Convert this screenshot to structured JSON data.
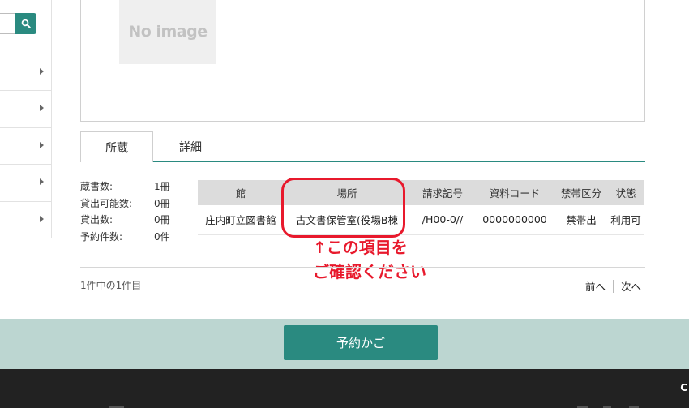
{
  "sidebar": {
    "items": [
      "",
      "",
      "",
      "",
      ""
    ]
  },
  "image_panel": {
    "placeholder_text": "No image"
  },
  "tabs": [
    {
      "label": "所蔵",
      "active": true
    },
    {
      "label": "詳細",
      "active": false
    }
  ],
  "stats": [
    {
      "label": "蔵書数:",
      "value": "1冊"
    },
    {
      "label": "貸出可能数:",
      "value": "0冊"
    },
    {
      "label": "貸出数:",
      "value": "0冊"
    },
    {
      "label": "予約件数:",
      "value": "0件"
    }
  ],
  "holdings": {
    "headers": [
      "館",
      "場所",
      "請求記号",
      "資料コード",
      "禁帯区分",
      "状態"
    ],
    "rows": [
      [
        "庄内町立図書館",
        "古文書保管室(役場B棟",
        "/H00-0//",
        "0000000000",
        "禁帯出",
        "利用可"
      ]
    ]
  },
  "annotation": {
    "line1": "↑この項目を",
    "line2": "ご確認ください"
  },
  "results": {
    "count_text": "1件中の1件目",
    "prev_label": "前へ",
    "next_label": "次へ"
  },
  "reserve": {
    "label": "予約かご"
  },
  "footer": {
    "char": "C"
  },
  "colors": {
    "accent": "#2a8a80",
    "band": "#bcd6d1",
    "annotation": "#e8192c",
    "footer": "#222222"
  }
}
